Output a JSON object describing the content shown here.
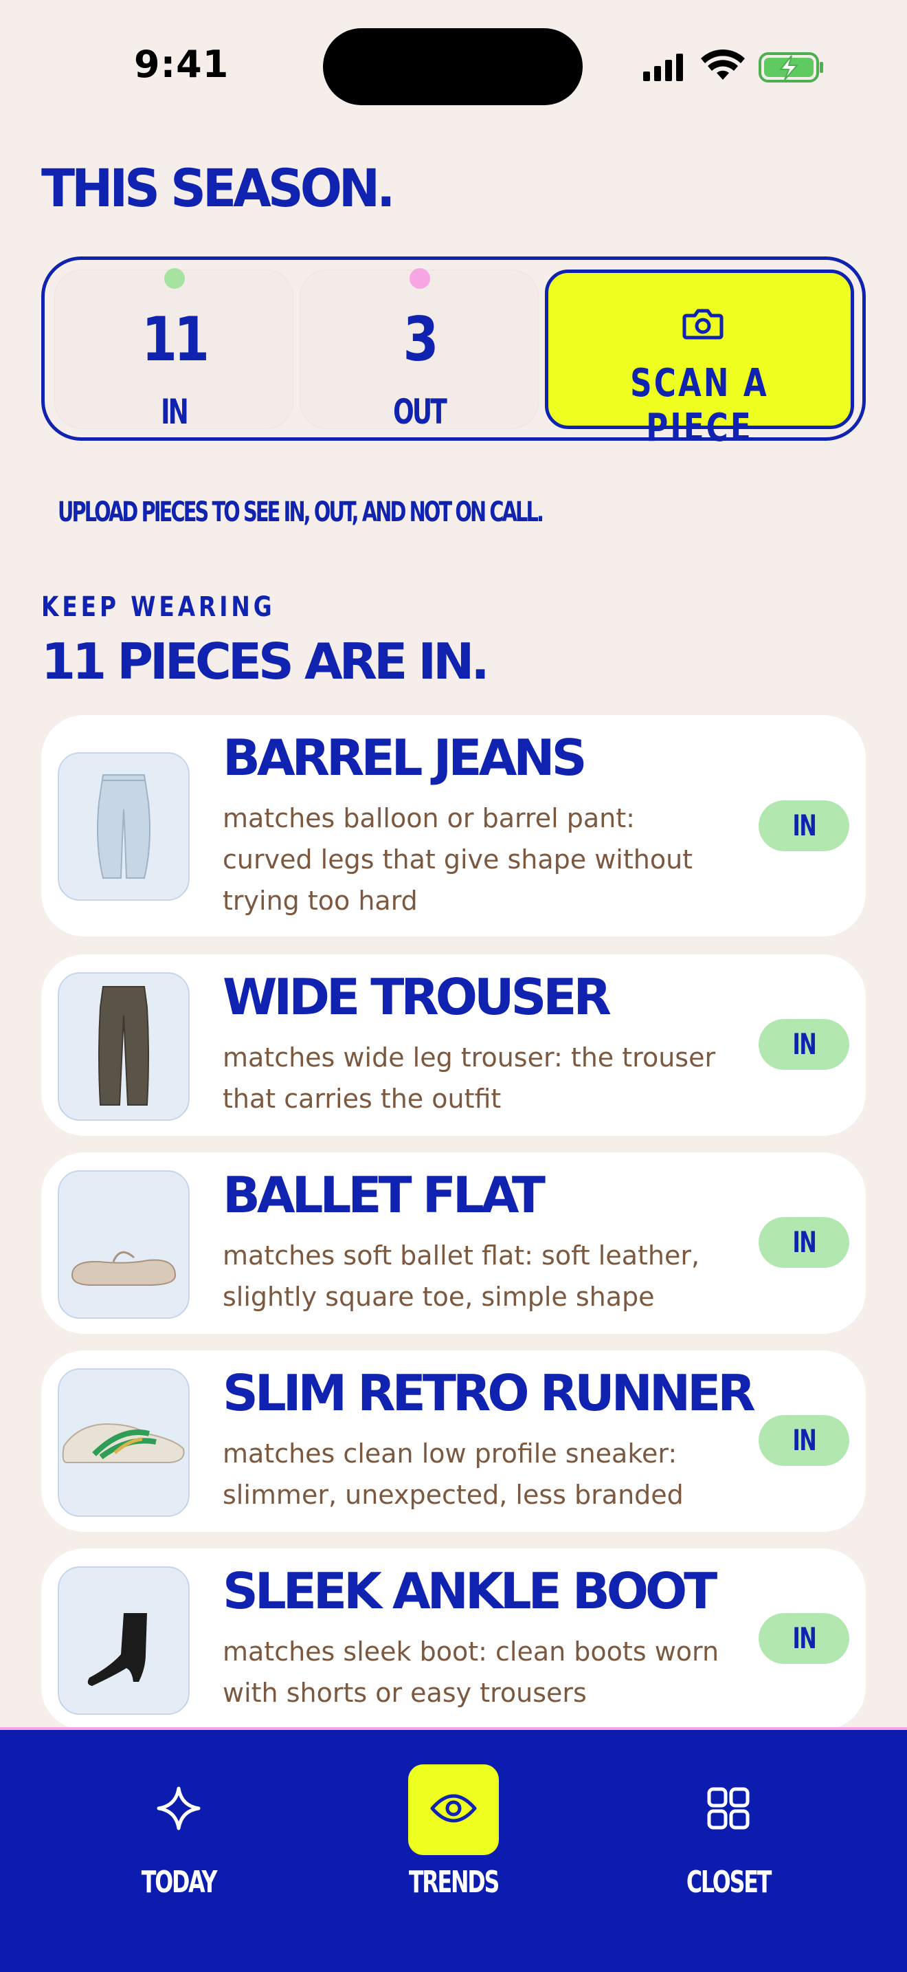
{
  "status_bar": {
    "time": "9:41"
  },
  "page_title": "THIS SEASON.",
  "stats": {
    "in": {
      "value": "11",
      "label": "IN",
      "dot_color": "#a6e3a1"
    },
    "out": {
      "value": "3",
      "label": "OUT",
      "dot_color": "#f7a6e3"
    },
    "scan_button": {
      "label": "SCAN A PIECE",
      "icon": "camera-icon"
    }
  },
  "upload_hint": "UPLOAD PIECES TO SEE IN, OUT, AND NOT ON CALL.",
  "section": {
    "eyebrow": "KEEP WEARING",
    "title": "11 PIECES ARE IN."
  },
  "items": [
    {
      "title": "BARREL JEANS",
      "description": "matches balloon or barrel pant: curved legs that give shape without trying too hard",
      "badge": "IN",
      "thumb": "jeans"
    },
    {
      "title": "WIDE TROUSER",
      "description": "matches wide leg trouser: the trouser that carries the outfit",
      "badge": "IN",
      "thumb": "trouser"
    },
    {
      "title": "BALLET FLAT",
      "description": "matches soft ballet flat: soft leather, slightly square toe, simple shape",
      "badge": "IN",
      "thumb": "flat"
    },
    {
      "title": "SLIM RETRO RUNNER",
      "description": "matches clean low profile sneaker: slimmer, unexpected, less branded",
      "badge": "IN",
      "thumb": "sneaker"
    },
    {
      "title": "SLEEK ANKLE BOOT",
      "description": "matches sleek boot: clean boots worn with shorts or easy trousers",
      "badge": "IN",
      "thumb": "boot"
    }
  ],
  "tab_bar": {
    "tabs": [
      {
        "label": "TODAY",
        "icon": "sparkle-icon",
        "active": false
      },
      {
        "label": "TRENDS",
        "icon": "eye-icon",
        "active": true
      },
      {
        "label": "CLOSET",
        "icon": "grid-icon",
        "active": false
      }
    ]
  },
  "colors": {
    "background": "#f5eeeb",
    "brand_blue": "#0f23b0",
    "accent_yellow": "#eeff1f",
    "badge_green": "#b3e7b0",
    "description_brown": "#7b5840"
  }
}
